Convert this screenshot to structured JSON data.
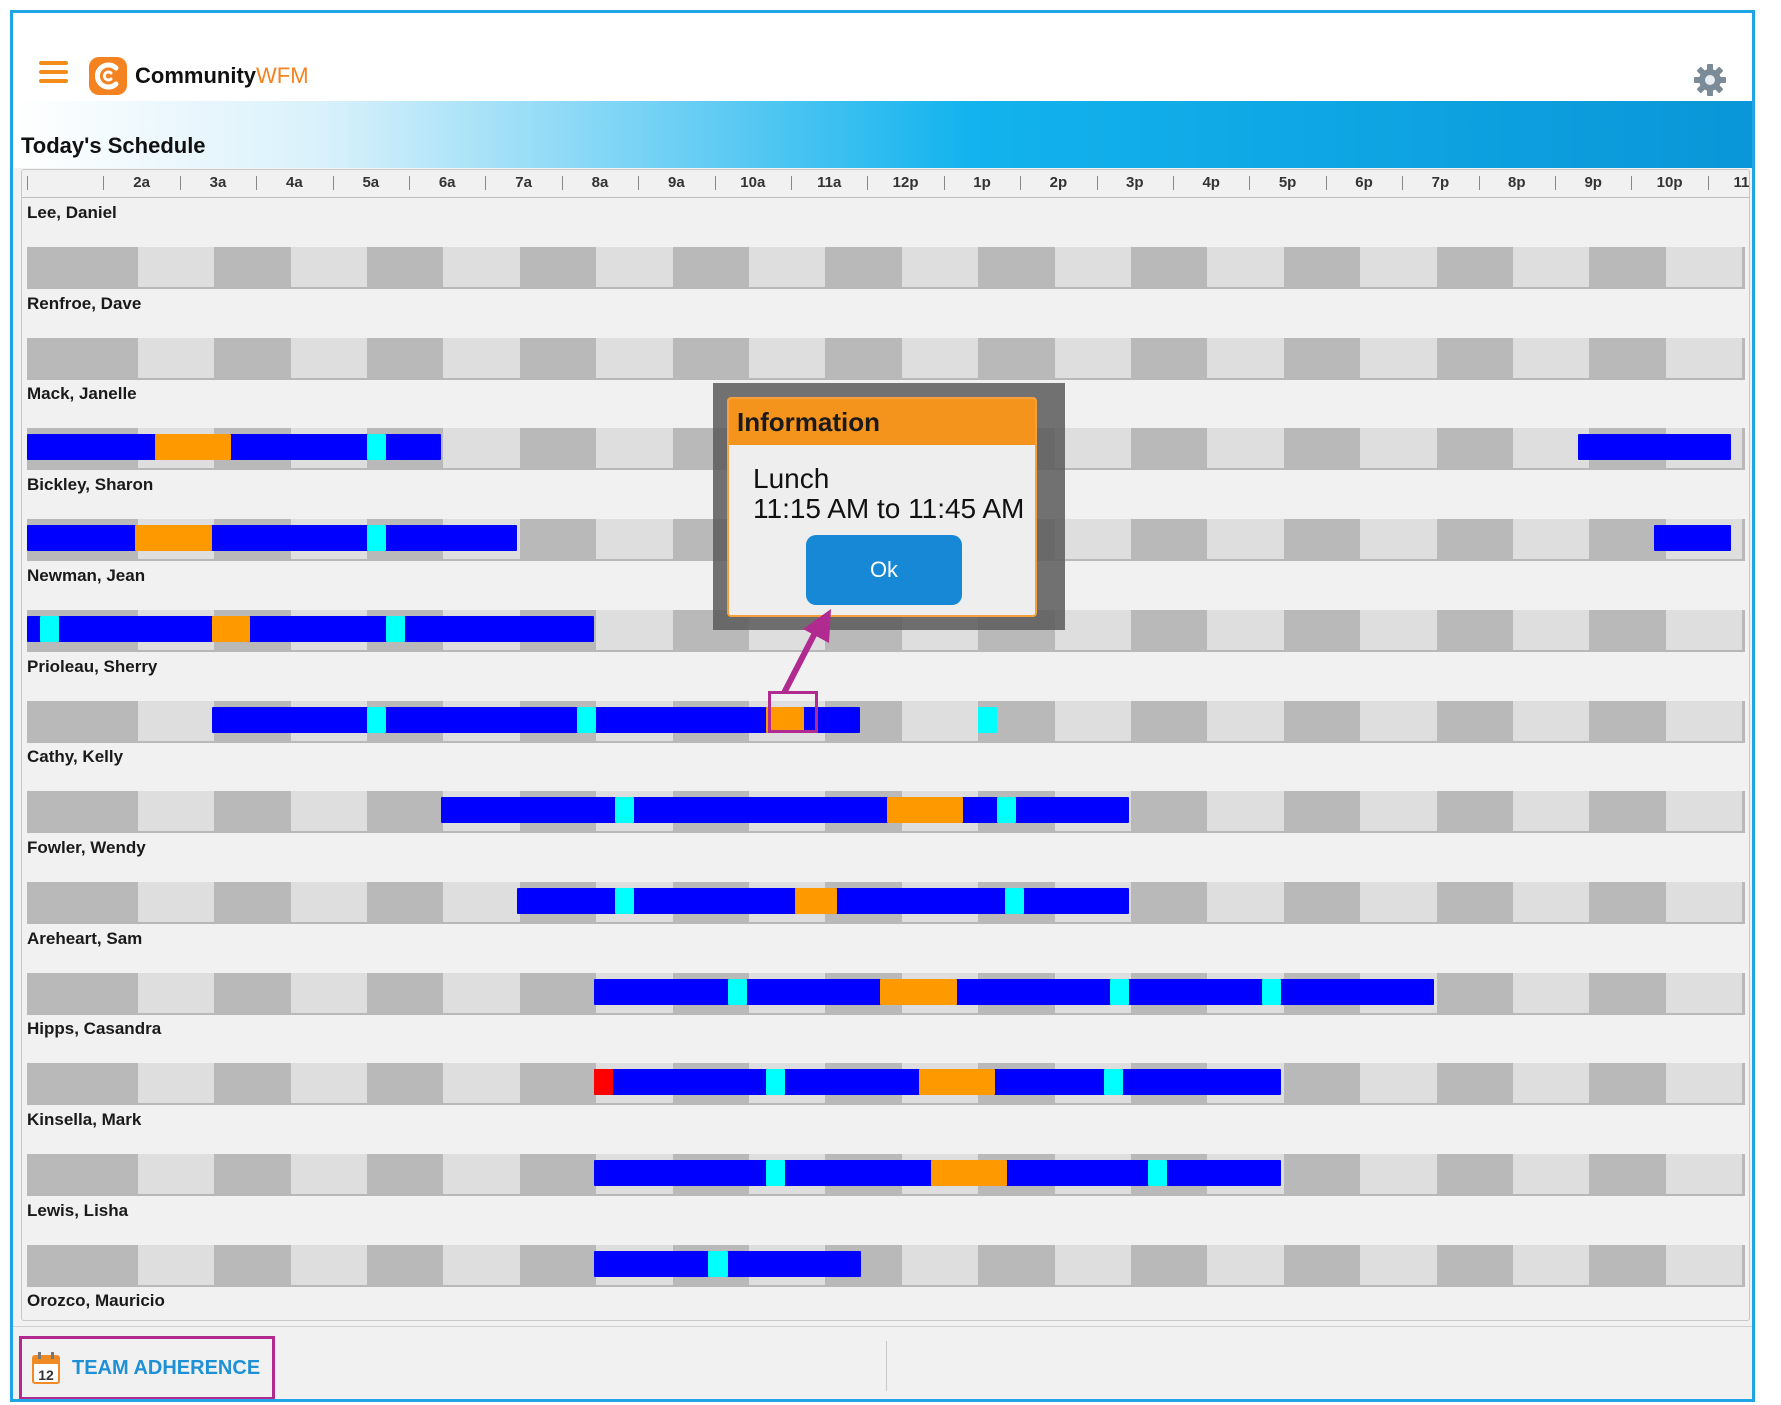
{
  "app": {
    "brand_main": "Community",
    "brand_accent": "WFM",
    "accent_color": "#f5821f"
  },
  "icons": {
    "menu": "hamburger-menu-icon",
    "settings": "gear-icon",
    "logo": "communitywfm-logo-icon",
    "calendar": "calendar-icon"
  },
  "page_title": "Today's Schedule",
  "hours": [
    "",
    "2a",
    "3a",
    "4a",
    "5a",
    "6a",
    "7a",
    "8a",
    "9a",
    "10a",
    "11a",
    "12p",
    "1p",
    "2p",
    "3p",
    "4p",
    "5p",
    "6p",
    "7p",
    "8p",
    "9p",
    "10p",
    "11p"
  ],
  "segment_colors": {
    "work": "#0000ff",
    "lunch": "#ff9900",
    "break": "#00ffff",
    "exception": "#ff0000"
  },
  "employees": [
    {
      "name": "Lee, Daniel",
      "segments": []
    },
    {
      "name": "Renfroe, Dave",
      "segments": []
    },
    {
      "name": "Mack, Janelle",
      "segments": [
        {
          "type": "work",
          "start": 0.0,
          "end": 5.42
        },
        {
          "type": "lunch",
          "start": 1.67,
          "end": 2.67
        },
        {
          "type": "break",
          "start": 4.45,
          "end": 4.7
        },
        {
          "type": "work",
          "start": 20.3,
          "end": 22.3
        }
      ]
    },
    {
      "name": "Bickley, Sharon",
      "segments": [
        {
          "type": "work",
          "start": 0.0,
          "end": 6.42
        },
        {
          "type": "lunch",
          "start": 1.42,
          "end": 2.42
        },
        {
          "type": "break",
          "start": 4.45,
          "end": 4.7
        },
        {
          "type": "work",
          "start": 21.3,
          "end": 22.3
        }
      ]
    },
    {
      "name": "Newman, Jean",
      "segments": [
        {
          "type": "work",
          "start": 0.0,
          "end": 7.42
        },
        {
          "type": "break",
          "start": 0.17,
          "end": 0.42
        },
        {
          "type": "lunch",
          "start": 2.42,
          "end": 2.92
        },
        {
          "type": "break",
          "start": 4.7,
          "end": 4.95
        }
      ]
    },
    {
      "name": "Prioleau, Sherry",
      "segments": [
        {
          "type": "work",
          "start": 2.42,
          "end": 10.9
        },
        {
          "type": "break",
          "start": 4.45,
          "end": 4.7
        },
        {
          "type": "break",
          "start": 7.2,
          "end": 7.45
        },
        {
          "type": "lunch",
          "start": 9.67,
          "end": 10.17
        },
        {
          "type": "break",
          "start": 12.45,
          "end": 12.7
        }
      ]
    },
    {
      "name": "Cathy, Kelly",
      "segments": [
        {
          "type": "work",
          "start": 5.42,
          "end": 14.42
        },
        {
          "type": "break",
          "start": 7.7,
          "end": 7.95
        },
        {
          "type": "lunch",
          "start": 11.25,
          "end": 12.25
        },
        {
          "type": "break",
          "start": 12.7,
          "end": 12.95
        }
      ]
    },
    {
      "name": "Fowler, Wendy",
      "segments": [
        {
          "type": "work",
          "start": 6.42,
          "end": 14.42
        },
        {
          "type": "break",
          "start": 7.7,
          "end": 7.95
        },
        {
          "type": "lunch",
          "start": 10.05,
          "end": 10.6
        },
        {
          "type": "break",
          "start": 12.8,
          "end": 13.05
        }
      ]
    },
    {
      "name": "Areheart, Sam",
      "segments": [
        {
          "type": "work",
          "start": 7.42,
          "end": 18.42
        },
        {
          "type": "break",
          "start": 9.17,
          "end": 9.42
        },
        {
          "type": "lunch",
          "start": 11.17,
          "end": 12.17
        },
        {
          "type": "break",
          "start": 14.17,
          "end": 14.42
        },
        {
          "type": "break",
          "start": 16.17,
          "end": 16.42
        }
      ]
    },
    {
      "name": "Hipps, Casandra",
      "segments": [
        {
          "type": "work",
          "start": 7.42,
          "end": 16.42
        },
        {
          "type": "exception",
          "start": 7.42,
          "end": 7.67
        },
        {
          "type": "break",
          "start": 9.67,
          "end": 9.92
        },
        {
          "type": "lunch",
          "start": 11.67,
          "end": 12.67
        },
        {
          "type": "break",
          "start": 14.1,
          "end": 14.35
        }
      ]
    },
    {
      "name": "Kinsella, Mark",
      "segments": [
        {
          "type": "work",
          "start": 7.42,
          "end": 16.42
        },
        {
          "type": "break",
          "start": 9.67,
          "end": 9.92
        },
        {
          "type": "lunch",
          "start": 11.83,
          "end": 12.83
        },
        {
          "type": "break",
          "start": 14.67,
          "end": 14.92
        }
      ]
    },
    {
      "name": "Lewis, Lisha",
      "segments": [
        {
          "type": "work",
          "start": 7.42,
          "end": 10.92
        },
        {
          "type": "break",
          "start": 8.92,
          "end": 9.17
        }
      ]
    },
    {
      "name": "Orozco, Mauricio",
      "segments": []
    }
  ],
  "popup": {
    "title": "Information",
    "line1": "Lunch",
    "line2": "11:15 AM to 11:45 AM",
    "ok_label": "Ok"
  },
  "footer": {
    "calendar_day": "12",
    "team_adherence_label": "TEAM ADHERENCE"
  }
}
